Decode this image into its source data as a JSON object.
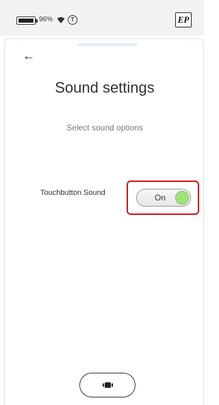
{
  "status_bar": {
    "battery_percent": "96%",
    "battery_level": 0.96,
    "icons": [
      "battery-icon",
      "wifi-icon",
      "t-circle-icon",
      "ep-logo"
    ],
    "logo_text": "EP"
  },
  "screen": {
    "back_icon": "←",
    "title": "Sound settings",
    "subtitle": "Select sound options"
  },
  "settings": {
    "touchbutton_sound": {
      "label": "Touchbutton Sound",
      "toggle_text": "On",
      "enabled": true
    }
  },
  "colors": {
    "highlight": "#d0111b",
    "toggle_knob_on": "#9ee37a",
    "card_border": "#cfe3f2"
  }
}
